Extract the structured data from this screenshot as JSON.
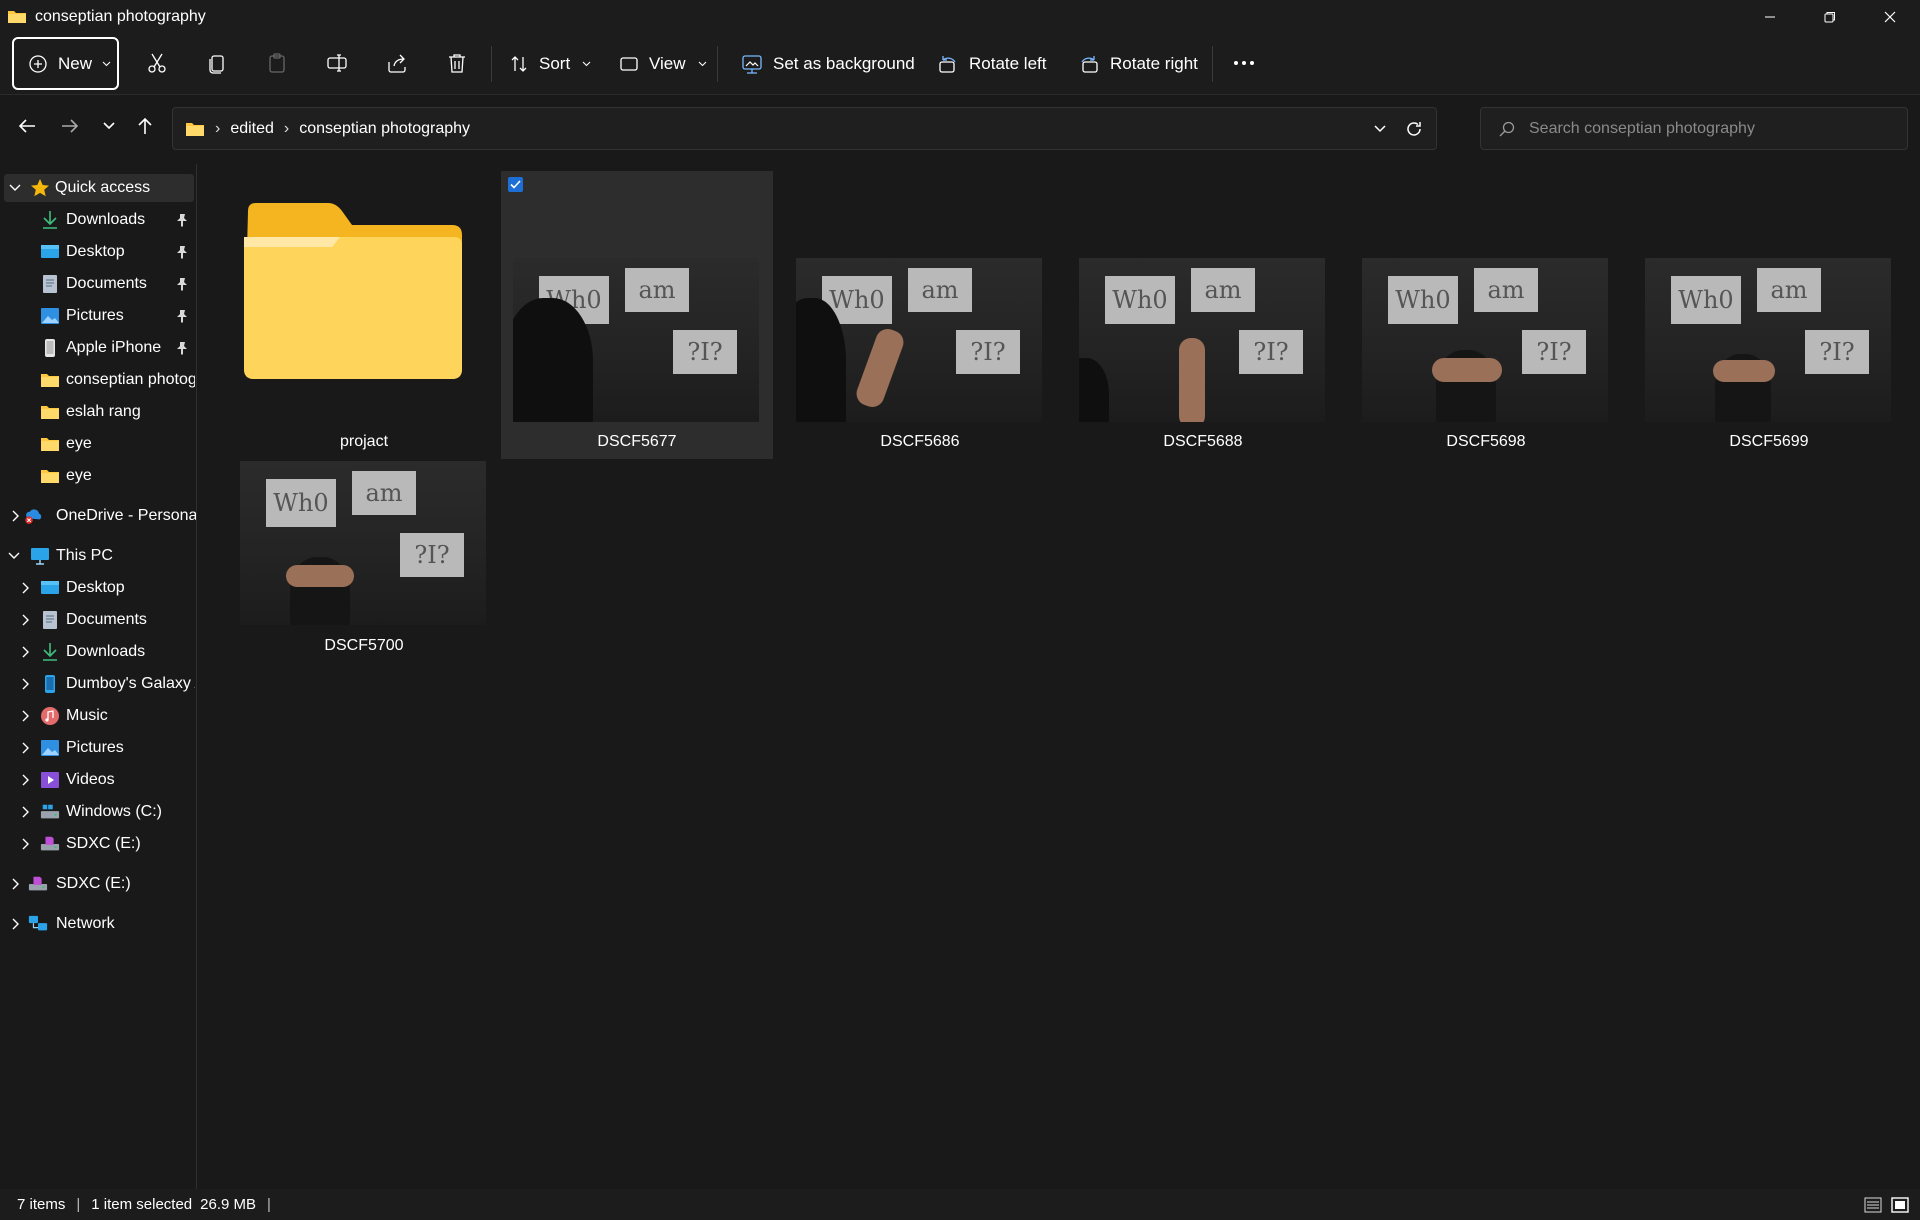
{
  "window": {
    "title": "conseptian photography"
  },
  "toolbar": {
    "new_label": "New",
    "sort_label": "Sort",
    "view_label": "View",
    "set_background_label": "Set as background",
    "rotate_left_label": "Rotate left",
    "rotate_right_label": "Rotate right",
    "icons": [
      "cut-icon",
      "copy-icon",
      "paste-icon",
      "rename-icon",
      "share-icon",
      "delete-icon",
      "more-icon"
    ]
  },
  "address": {
    "crumbs": [
      "edited",
      "conseptian photography"
    ],
    "search_placeholder": "Search conseptian photography"
  },
  "sidebar": {
    "quick_access": {
      "label": "Quick access",
      "items": [
        {
          "label": "Downloads",
          "icon": "download-icon",
          "pinned": true
        },
        {
          "label": "Desktop",
          "icon": "desktop-icon",
          "pinned": true
        },
        {
          "label": "Documents",
          "icon": "documents-icon",
          "pinned": true
        },
        {
          "label": "Pictures",
          "icon": "pictures-icon",
          "pinned": true
        },
        {
          "label": "Apple iPhone",
          "icon": "phone-icon",
          "pinned": true
        },
        {
          "label": "conseptian photography",
          "icon": "folder-icon",
          "pinned": false
        },
        {
          "label": "eslah rang",
          "icon": "folder-icon",
          "pinned": false
        },
        {
          "label": "eye",
          "icon": "folder-icon",
          "pinned": false
        },
        {
          "label": "eye",
          "icon": "folder-icon",
          "pinned": false
        }
      ]
    },
    "onedrive": {
      "label": "OneDrive - Personal"
    },
    "this_pc": {
      "label": "This PC",
      "items": [
        {
          "label": "Desktop",
          "icon": "desktop-icon"
        },
        {
          "label": "Documents",
          "icon": "documents-icon"
        },
        {
          "label": "Downloads",
          "icon": "download-icon"
        },
        {
          "label": "Dumboy's Galaxy A",
          "icon": "phone-icon"
        },
        {
          "label": "Music",
          "icon": "music-icon"
        },
        {
          "label": "Pictures",
          "icon": "pictures-icon"
        },
        {
          "label": "Videos",
          "icon": "videos-icon"
        },
        {
          "label": "Windows (C:)",
          "icon": "drive-icon"
        },
        {
          "label": "SDXC (E:)",
          "icon": "sd-card-icon"
        }
      ]
    },
    "sdxc": {
      "label": "SDXC (E:)"
    },
    "network": {
      "label": "Network"
    }
  },
  "files": [
    {
      "name": "projact",
      "type": "folder",
      "selected": false
    },
    {
      "name": "DSCF5677",
      "type": "image",
      "selected": true
    },
    {
      "name": "DSCF5686",
      "type": "image",
      "selected": false
    },
    {
      "name": "DSCF5688",
      "type": "image",
      "selected": false
    },
    {
      "name": "DSCF5698",
      "type": "image",
      "selected": false
    },
    {
      "name": "DSCF5699",
      "type": "image",
      "selected": false
    },
    {
      "name": "DSCF5700",
      "type": "image",
      "selected": false
    }
  ],
  "status": {
    "item_count": "7 items",
    "selection": "1 item selected",
    "size": "26.9 MB"
  },
  "colors": {
    "background": "#191919",
    "accent": "#1d6fd6",
    "folder_yellow": "#ffd45a"
  }
}
